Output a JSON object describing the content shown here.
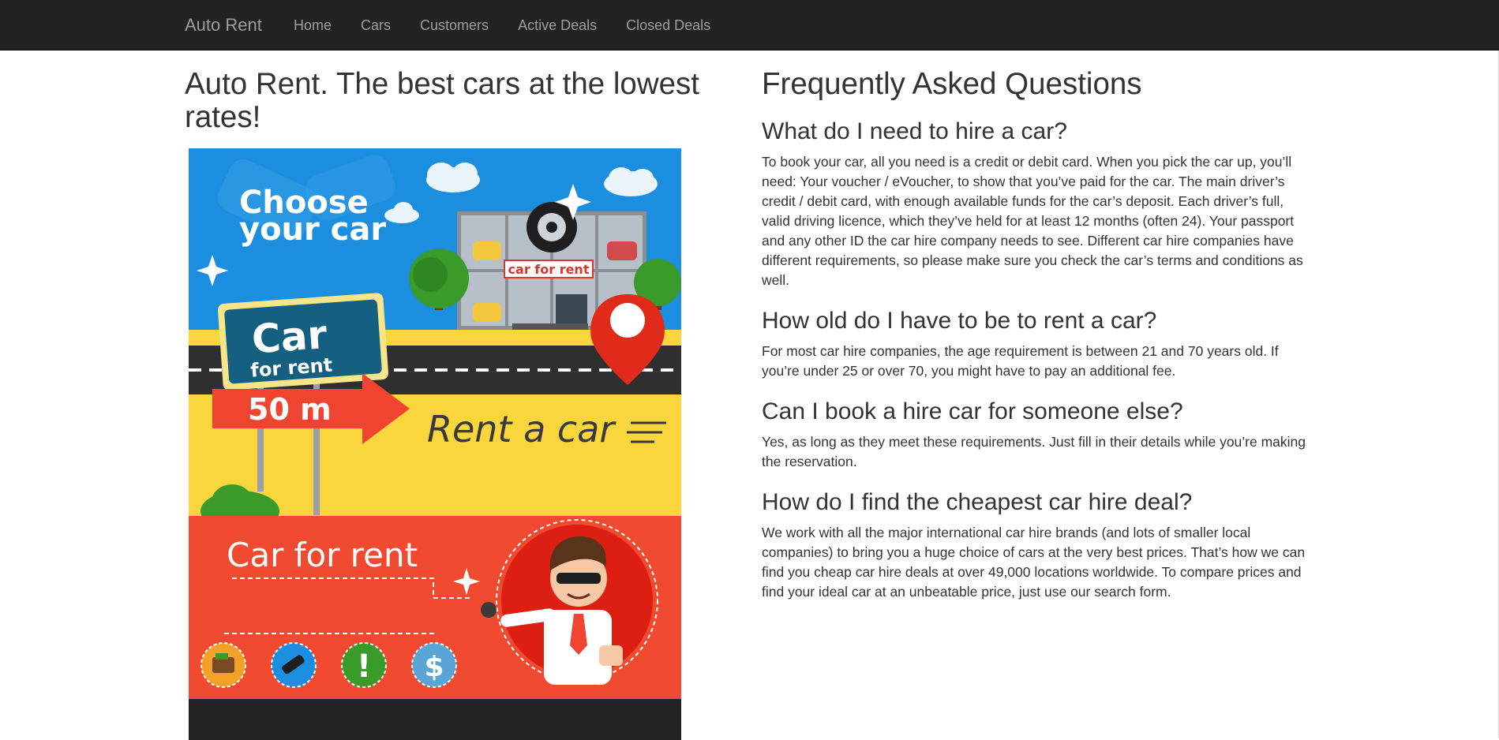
{
  "navbar": {
    "brand": "Auto Rent",
    "links": [
      "Home",
      "Cars",
      "Customers",
      "Active Deals",
      "Closed Deals"
    ]
  },
  "hero": {
    "title": "Auto Rent. The best cars at the lowest rates!"
  },
  "poster": {
    "choose_line1": "Choose",
    "choose_line2": "your car",
    "sign_big": "Car",
    "sign_small": "for rent",
    "distance": "50 m",
    "rent_a_car": "Rent a car",
    "building_sign": "car for rent",
    "car_for_rent": "Car for rent",
    "exclamation": "!",
    "dollar": "$",
    "colors": {
      "sky": "#1b8ee0",
      "road": "#2f2f2f",
      "yellow": "#f9d63b",
      "red": "#f04a30",
      "dark": "#232323",
      "sign_teal": "#155f80"
    }
  },
  "faq": {
    "title": "Frequently Asked Questions",
    "items": [
      {
        "q": "What do I need to hire a car?",
        "a": "To book your car, all you need is a credit or debit card. When you pick the car up, you’ll need: Your voucher / eVoucher, to show that you’ve paid for the car. The main driver’s credit / debit card, with enough available funds for the car’s deposit. Each driver’s full, valid driving licence, which they’ve held for at least 12 months (often 24). Your passport and any other ID the car hire company needs to see. Different car hire companies have different requirements, so please make sure you check the car’s terms and conditions as well."
      },
      {
        "q": "How old do I have to be to rent a car?",
        "a": "For most car hire companies, the age requirement is between 21 and 70 years old. If you’re under 25 or over 70, you might have to pay an additional fee."
      },
      {
        "q": "Can I book a hire car for someone else?",
        "a": "Yes, as long as they meet these requirements. Just fill in their details while you’re making the reservation."
      },
      {
        "q": "How do I find the cheapest car hire deal?",
        "a": "We work with all the major international car hire brands (and lots of smaller local companies) to bring you a huge choice of cars at the very best prices. That’s how we can find you cheap car hire deals at over 49,000 locations worldwide. To compare prices and find your ideal car at an unbeatable price, just use our search form."
      }
    ]
  }
}
